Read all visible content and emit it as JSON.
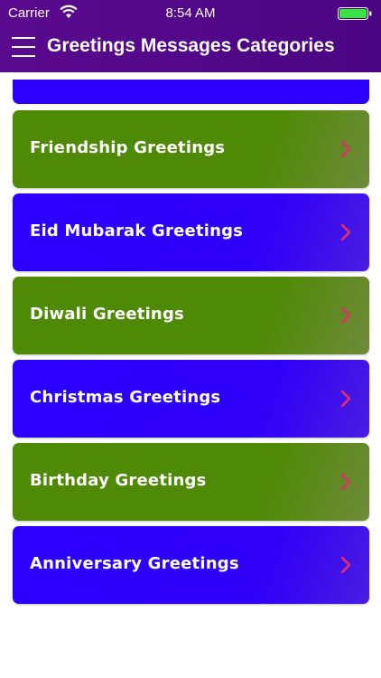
{
  "status_bar": {
    "carrier": "Carrier",
    "time": "8:54 AM",
    "wifi_icon": "wifi-icon",
    "battery_icon": "battery-icon"
  },
  "nav": {
    "title": "Greetings Messages Categories",
    "menu_icon": "hamburger-menu-icon"
  },
  "colors": {
    "header": "#5a0a8e",
    "green_card": "#4e8a05",
    "blue_card": "#2b00ff",
    "chevron": "#e0306a"
  },
  "categories": [
    {
      "label": "Friendship Greetings",
      "color": "green"
    },
    {
      "label": "Eid Mubarak Greetings",
      "color": "blue"
    },
    {
      "label": "Diwali Greetings",
      "color": "green"
    },
    {
      "label": "Christmas Greetings",
      "color": "blue"
    },
    {
      "label": "Birthday Greetings",
      "color": "green"
    },
    {
      "label": "Anniversary Greetings",
      "color": "blue"
    }
  ]
}
